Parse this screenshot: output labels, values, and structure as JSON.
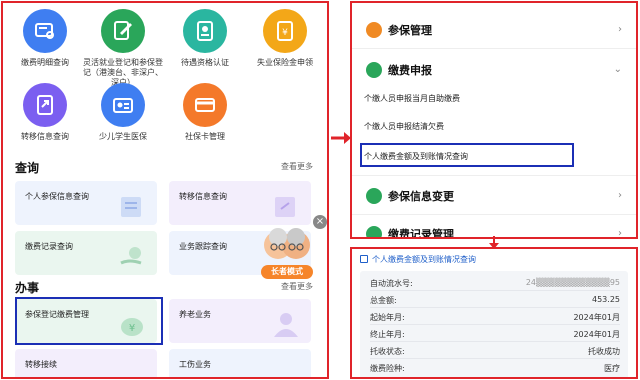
{
  "services": {
    "row1": [
      {
        "label": "缴费明细查询",
        "icon": "search-list-icon",
        "color": "#3f7ef1"
      },
      {
        "label": "灵活就业登记和参保登记（港澳台、非深户、深户）",
        "icon": "edit-form-icon",
        "color": "#2aa65a"
      },
      {
        "label": "待遇资格认证",
        "icon": "id-card-icon",
        "color": "#2ab6a0"
      },
      {
        "label": "失业保险金申领",
        "icon": "document-apply-icon",
        "color": "#f3a718"
      }
    ],
    "row2": [
      {
        "label": "转移信息查询",
        "icon": "transfer-doc-icon",
        "color": "#7b5ff0"
      },
      {
        "label": "少儿学生医保",
        "icon": "student-card-icon",
        "color": "#3f7ef1"
      },
      {
        "label": "社保卡管理",
        "icon": "card-icon",
        "color": "#f4792a"
      }
    ]
  },
  "query": {
    "title": "查询",
    "see_more": "查看更多",
    "cards": [
      {
        "label": "个人参保信息查询"
      },
      {
        "label": "转移信息查询"
      },
      {
        "label": "缴费记录查询"
      },
      {
        "label": "业务跟踪查询"
      }
    ],
    "elder_badge": "长者模式"
  },
  "business": {
    "title": "办事",
    "see_more": "查看更多",
    "cards": [
      {
        "label": "参保登记缴费管理"
      },
      {
        "label": "养老业务"
      },
      {
        "label": "转移接续"
      },
      {
        "label": "工伤业务"
      }
    ]
  },
  "menu": {
    "items": [
      {
        "label": "参保管理",
        "chevron": "›",
        "icon_color": "#f08a24"
      },
      {
        "label": "缴费申报",
        "chevron": "⌄",
        "icon_color": "#2aa65a"
      },
      {
        "label": "参保信息变更",
        "chevron": "›",
        "icon_color": "#2aa65a"
      },
      {
        "label": "缴费记录管理",
        "chevron": "›",
        "icon_color": "#2aa65a"
      }
    ],
    "sub_items": [
      {
        "label": "个缴人员申报当月自助缴费"
      },
      {
        "label": "个缴人员申报结清欠费"
      },
      {
        "label": "个人缴费金额及到账情况查询"
      }
    ]
  },
  "detail": {
    "title": "个人缴费金额及到账情况查询",
    "rows": [
      {
        "key": "自动流水号:",
        "value": "24▒▒▒▒▒▒▒▒▒▒▒▒95"
      },
      {
        "key": "总金额:",
        "value": "453.25"
      },
      {
        "key": "起始年月:",
        "value": "2024年01月"
      },
      {
        "key": "终止年月:",
        "value": "2024年01月"
      },
      {
        "key": "托收状态:",
        "value": "托收成功"
      },
      {
        "key": "缴费险种:",
        "value": "医疗"
      }
    ]
  },
  "colors": {
    "highlight_red": "#e0242a",
    "highlight_blue": "#1b2fb5",
    "link_blue": "#1f5fc9"
  }
}
